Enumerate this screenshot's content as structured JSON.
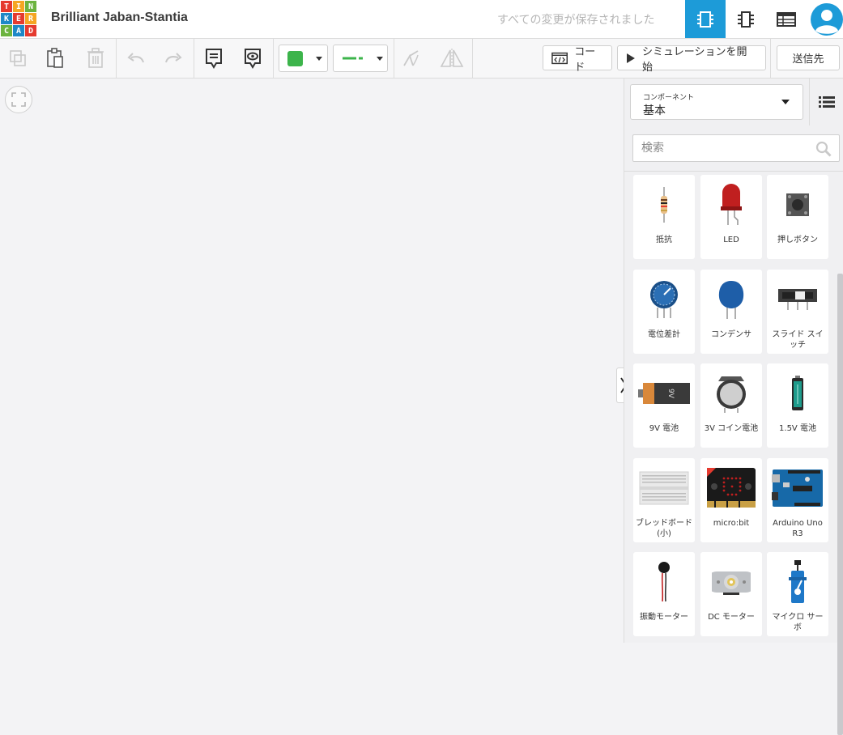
{
  "app": {
    "logo_letters": [
      "T",
      "I",
      "N",
      "K",
      "E",
      "R",
      "C",
      "A",
      "D"
    ],
    "logo_colors": [
      "#e53a2f",
      "#f5a623",
      "#6cb33f",
      "#1e88c7",
      "#e53a2f",
      "#f5a623",
      "#6cb33f",
      "#1e88c7",
      "#e53a2f"
    ],
    "project_title": "Brilliant Jaban-Stantia",
    "save_status": "すべての変更が保存されました",
    "accent_color": "#1d9bd8"
  },
  "toolbar": {
    "code_label": "コード",
    "simulate_label": "シミュレーションを開始",
    "send_label": "送信先",
    "fill_color": "#3cb44b",
    "wire_color": "#3cb44b"
  },
  "panel": {
    "components_small": "コンポーネント",
    "components_value": "基本",
    "search_placeholder": "検索"
  },
  "components": [
    {
      "label": "抵抗",
      "icon": "resistor-icon"
    },
    {
      "label": "LED",
      "icon": "led-icon"
    },
    {
      "label": "押しボタン",
      "icon": "pushbutton-icon"
    },
    {
      "label": "電位差計",
      "icon": "potentiometer-icon"
    },
    {
      "label": "コンデンサ",
      "icon": "capacitor-icon"
    },
    {
      "label": "スライド スイッチ",
      "icon": "slide-switch-icon"
    },
    {
      "label": "9V 電池",
      "icon": "battery-9v-icon"
    },
    {
      "label": "3V コイン電池",
      "icon": "coin-battery-icon"
    },
    {
      "label": "1.5V 電池",
      "icon": "battery-aa-icon"
    },
    {
      "label": "ブレッドボード (小)",
      "icon": "breadboard-icon"
    },
    {
      "label": "micro:bit",
      "icon": "microbit-icon"
    },
    {
      "label": "Arduino Uno R3",
      "icon": "arduino-icon"
    },
    {
      "label": "振動モーター",
      "icon": "vibration-motor-icon"
    },
    {
      "label": "DC モーター",
      "icon": "dc-motor-icon"
    },
    {
      "label": "マイクロ サーボ",
      "icon": "micro-servo-icon"
    }
  ],
  "battery_9v_text": "9V"
}
